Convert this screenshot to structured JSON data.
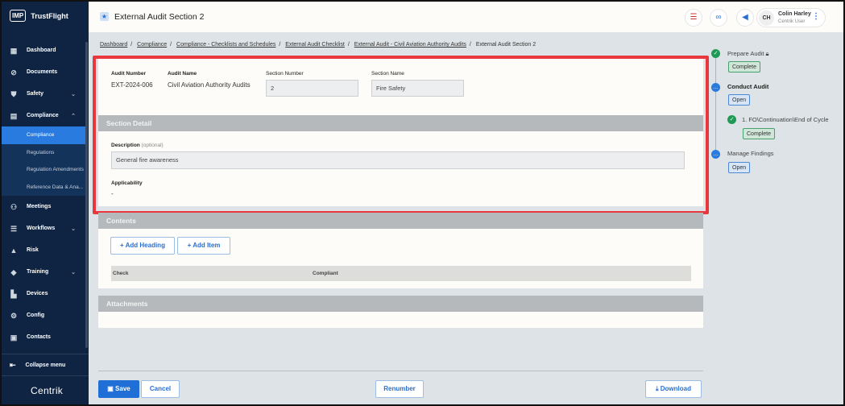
{
  "app": {
    "logo_badge": "IMP",
    "name": "TrustFlight",
    "footer_brand": "Centrik"
  },
  "sidebar": {
    "items": [
      {
        "label": "Dashboard",
        "icon": "dashboard-icon"
      },
      {
        "label": "Documents",
        "icon": "paperclip-icon"
      },
      {
        "label": "Safety",
        "icon": "shield-icon",
        "chevron": "⌄"
      },
      {
        "label": "Compliance",
        "icon": "compliance-icon",
        "chevron": "⌃"
      },
      {
        "label": "Meetings",
        "icon": "meetings-icon"
      },
      {
        "label": "Workflows",
        "icon": "workflows-icon",
        "chevron": "⌄"
      },
      {
        "label": "Risk",
        "icon": "risk-icon"
      },
      {
        "label": "Training",
        "icon": "graduation-cap-icon",
        "chevron": "⌄"
      },
      {
        "label": "Devices",
        "icon": "devices-icon"
      },
      {
        "label": "Config",
        "icon": "config-icon"
      },
      {
        "label": "Contacts",
        "icon": "contacts-icon"
      }
    ],
    "compliance_sub": [
      "Compliance",
      "Regulations",
      "Regulation Amendments",
      "Reference Data & Ana..."
    ],
    "collapse": "Collapse menu"
  },
  "header": {
    "title": "External Audit Section 2",
    "user_initials": "CH",
    "user_name": "Colin Harley",
    "user_role": "Centrik User"
  },
  "breadcrumb": [
    "Dashboard",
    "Compliance",
    "Compliance - Checklists and Schedules",
    "External Audit Checklist",
    "External Audit - Civil Aviation Authority Audits",
    "External Audit Section 2"
  ],
  "form": {
    "audit_number_label": "Audit Number",
    "audit_number": "EXT-2024-006",
    "audit_name_label": "Audit Name",
    "audit_name": "Civil Aviation Authority Audits",
    "section_number_label": "Section Number",
    "section_number": "2",
    "section_name_label": "Section Name",
    "section_name": "Fire Safety",
    "section_detail": "Section Detail",
    "description_label": "Description",
    "description_optional": "(optional)",
    "description": "General fire awareness",
    "applicability_label": "Applicability",
    "applicability": "-"
  },
  "contents": {
    "title": "Contents",
    "add_heading": "Add Heading",
    "add_item": "Add Item",
    "columns": [
      "Check",
      "Compliant"
    ]
  },
  "attachments": {
    "title": "Attachments"
  },
  "footer": {
    "save": "Save",
    "cancel": "Cancel",
    "renumber": "Renumber",
    "download": "Download"
  },
  "workflow": [
    {
      "label": "Prepare Audit",
      "status": "Complete",
      "state": "done"
    },
    {
      "label": "Conduct Audit",
      "status": "Open",
      "state": "current"
    },
    {
      "label": "1. FO\\Continuation\\End of Cycle",
      "status": "Complete",
      "state": "done"
    },
    {
      "label": "Manage Findings",
      "status": "Open",
      "state": "pending"
    }
  ],
  "colors": {
    "sidebar": "#0f2442",
    "accent": "#2a7be0",
    "highlight": "#e8383d"
  }
}
